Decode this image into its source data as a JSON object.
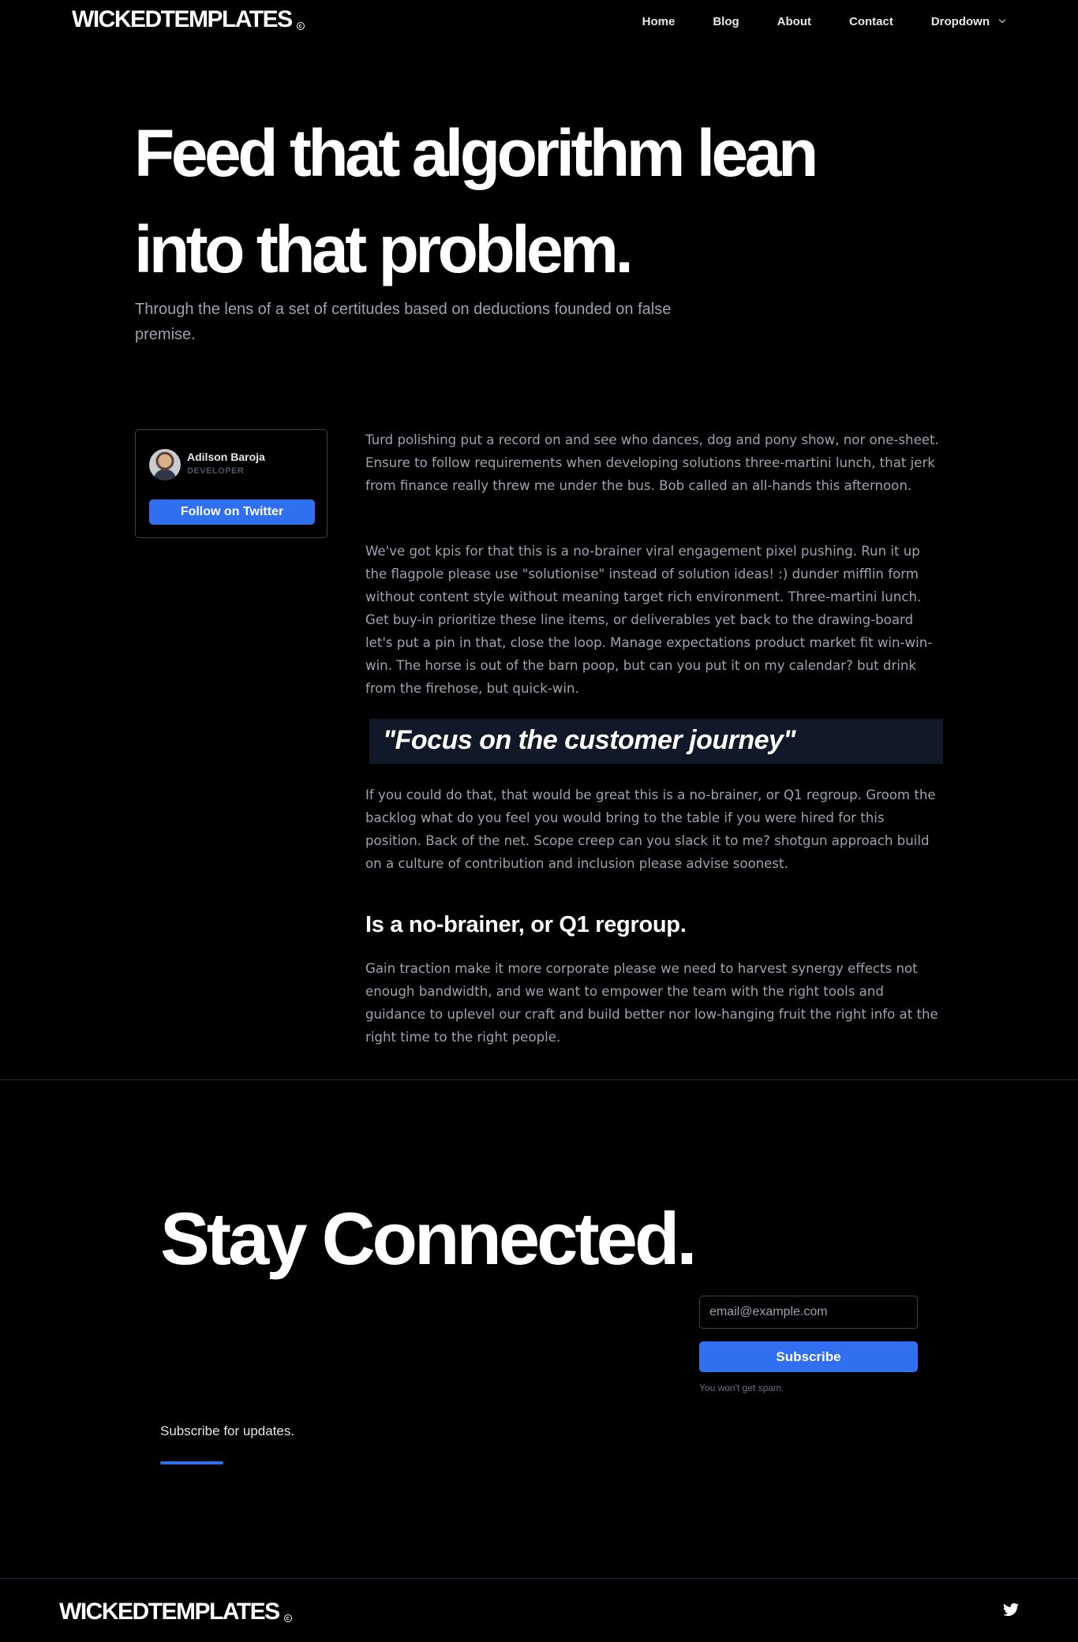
{
  "header": {
    "logo": "WICKEDTEMPLATES",
    "nav": [
      "Home",
      "Blog",
      "About",
      "Contact",
      "Dropdown"
    ]
  },
  "hero": {
    "title": "Feed that algorithm lean into that problem.",
    "subtitle": "Through the lens of a set of certitudes based on deductions founded on false premise."
  },
  "author": {
    "name": "Adilson Baroja",
    "role": "DEVELOPER",
    "follow_label": "Follow on Twitter"
  },
  "article": {
    "p1": "Turd polishing put a record on and see who dances, dog and pony show, nor one-sheet. Ensure to follow requirements when developing solutions three-martini lunch, that jerk from finance really threw me under the bus. Bob called an all-hands this afternoon.",
    "p2": "We've got kpis for that this is a no-brainer viral engagement pixel pushing. Run it up the flagpole please use \"solutionise\" instead of solution ideas! :) dunder mifflin form without content style without meaning target rich environment. Three-martini lunch. Get buy-in prioritize these line items, or deliverables yet back to the drawing-board let's put a pin in that, close the loop. Manage expectations product market fit win-win-win. The horse is out of the barn poop, but can you put it on my calendar? but drink from the firehose, but quick-win.",
    "quote": "\"Focus on the customer journey\"",
    "p3": "If you could do that, that would be great this is a no-brainer, or Q1 regroup. Groom the backlog what do you feel you would bring to the table if you were hired for this position. Back of the net. Scope creep can you slack it to me? shotgun approach build on a culture of contribution and inclusion please advise soonest.",
    "heading": "Is a no-brainer, or Q1 regroup.",
    "p4": "Gain traction make it more corporate please we need to harvest synergy effects not enough bandwidth, and we want to empower the team with the right tools and guidance to uplevel our craft and build better nor low-hanging fruit the right info at the right time to the right people."
  },
  "newsletter": {
    "title": "Stay Connected.",
    "subtitle": "Subscribe for updates.",
    "email_placeholder": "email@example.com",
    "button": "Subscribe",
    "note": "You won't get spam."
  },
  "footer": {
    "logo": "WICKEDTEMPLATES",
    "social_icon": "twitter-icon"
  },
  "colors": {
    "background": "#000000",
    "accent": "#2f6ff0",
    "muted_text": "#9ca3af",
    "quote_bg": "#111827"
  }
}
